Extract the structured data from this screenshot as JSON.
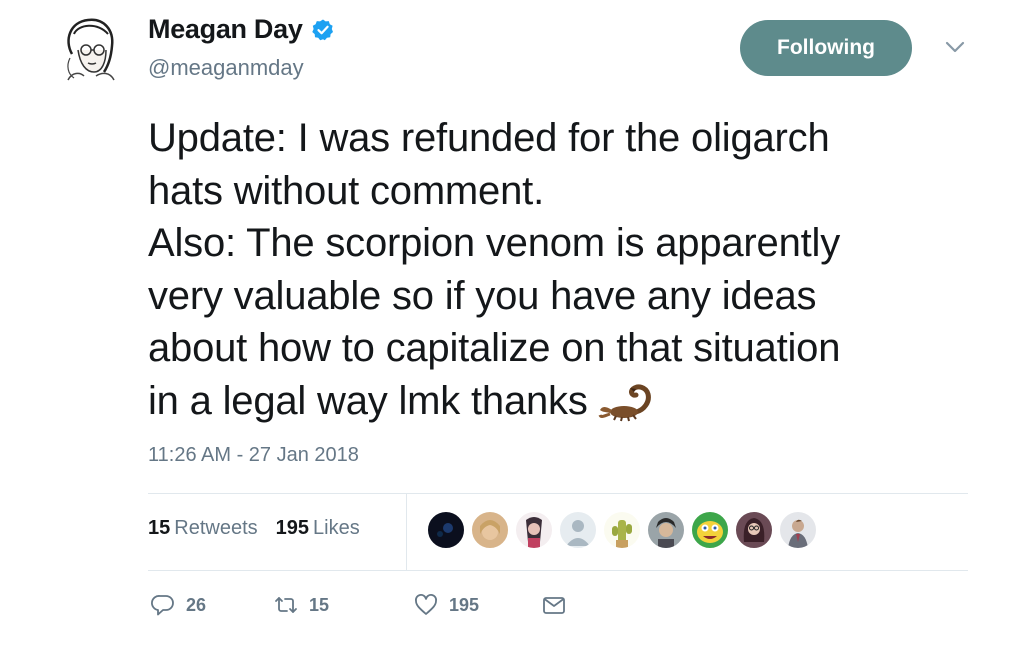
{
  "author": {
    "display_name": "Meagan Day",
    "handle": "@meaganmday",
    "verified": true
  },
  "follow_button": {
    "label": "Following",
    "color": "#5e8b8c"
  },
  "tweet": {
    "lines": [
      "Update: I was refunded for the oligarch",
      "hats without comment.",
      "Also: The scorpion venom is apparently",
      "very valuable so if you have any ideas",
      "about how to capitalize on that situation",
      "in a legal way lmk thanks"
    ],
    "trailing_emoji": "scorpion-emoji",
    "timestamp": "11:26 AM - 27 Jan 2018"
  },
  "stats": {
    "retweets_count": "15",
    "retweets_label": "Retweets",
    "likes_count": "195",
    "likes_label": "Likes"
  },
  "likers": [
    {
      "icon": "liker-avatar-dark",
      "color": "#0b0f1e"
    },
    {
      "icon": "liker-avatar-blonde",
      "color": "#d8b48a"
    },
    {
      "icon": "liker-avatar-portrait",
      "color": "#c9a3a8"
    },
    {
      "icon": "liker-avatar-default",
      "color": "#aab8c2"
    },
    {
      "icon": "liker-avatar-cactus",
      "color": "#b8c46a"
    },
    {
      "icon": "liker-avatar-man",
      "color": "#6f6a64"
    },
    {
      "icon": "liker-avatar-spongebob",
      "color": "#f3d23a"
    },
    {
      "icon": "liker-avatar-woman",
      "color": "#5a4048"
    },
    {
      "icon": "liker-avatar-suit",
      "color": "#8c8f98"
    }
  ],
  "actions": {
    "reply_count": "26",
    "retweet_count": "15",
    "like_count": "195"
  },
  "colors": {
    "text_primary": "#14171a",
    "text_secondary": "#657786",
    "verified_blue": "#1da1f2",
    "divider": "#e1e8ed"
  }
}
